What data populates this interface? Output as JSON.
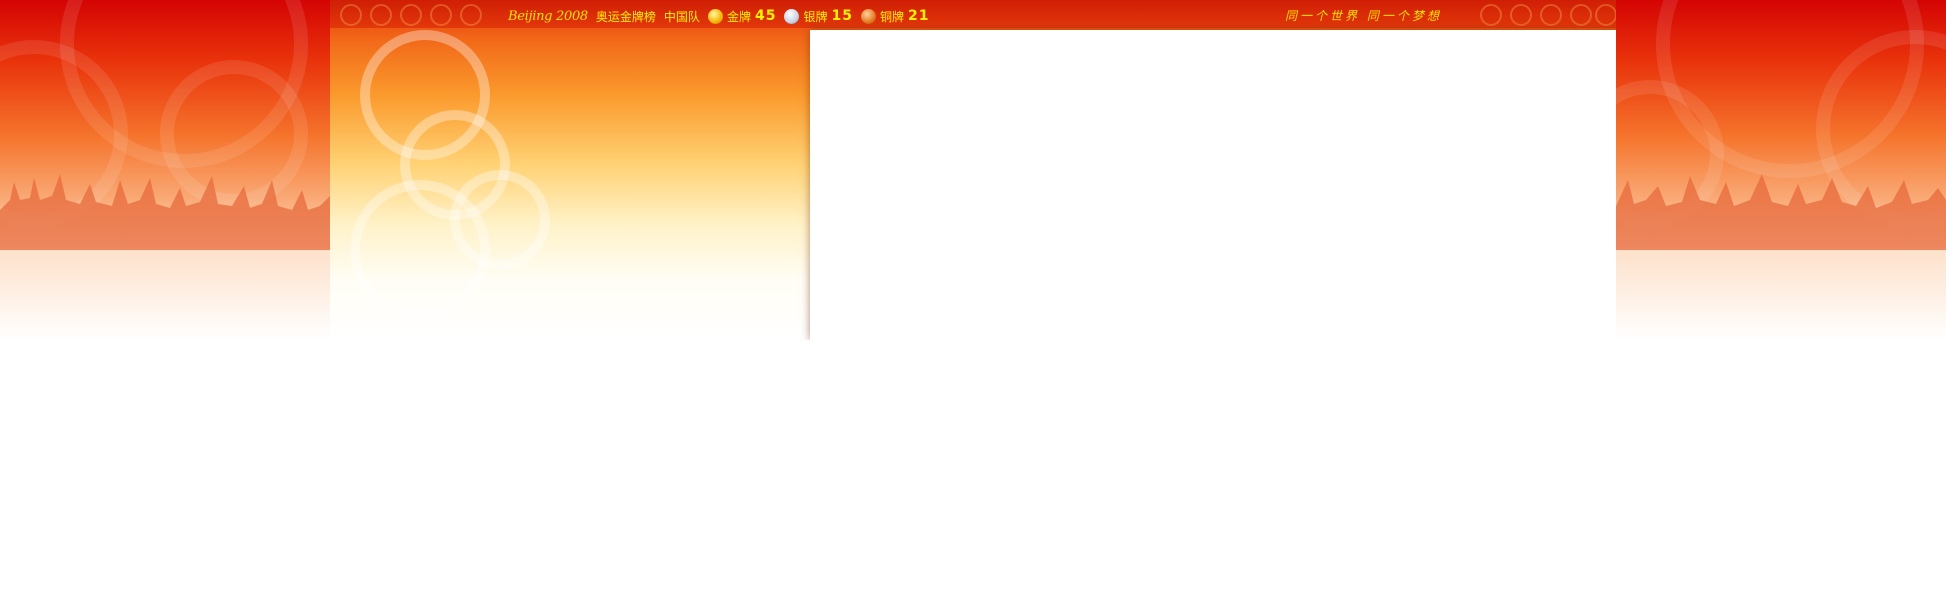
{
  "header": {
    "logo": "Beijing 2008",
    "board_title": "奥运金牌榜",
    "team": "中国队",
    "gold_label": "金牌",
    "gold_count": "45",
    "silver_label": "银牌",
    "silver_count": "15",
    "bronze_label": "铜牌",
    "bronze_count": "21",
    "slogan": "同一个世界 同一个梦想"
  },
  "icons": {
    "gold": "gold-medal-icon",
    "silver": "silver-medal-icon",
    "bronze": "bronze-medal-icon"
  },
  "colors": {
    "banner_red": "#d40404",
    "banner_orange": "#f26a19",
    "header_text": "#fff200",
    "panel": "#ffffff"
  }
}
